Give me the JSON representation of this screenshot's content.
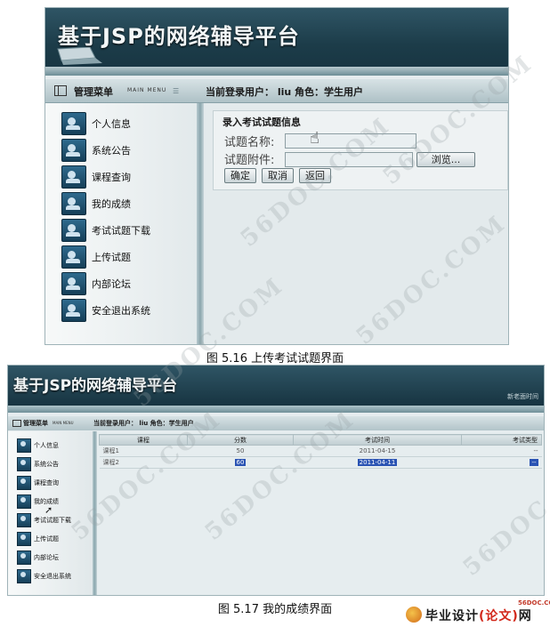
{
  "app": {
    "title": "基于JSP的网络辅导平台",
    "menu_title": "管理菜单",
    "menu_subtitle": "MAIN MENU",
    "user_bar": "当前登录用户：  liu     角色：学生用户",
    "user_bar_small": "当前登录用户：  liu    角色：学生用户",
    "top_right_link": "新老面时间"
  },
  "sidebar": {
    "items": [
      {
        "label": "个人信息"
      },
      {
        "label": "系统公告"
      },
      {
        "label": "课程查询"
      },
      {
        "label": "我的成绩"
      },
      {
        "label": "考试试题下载"
      },
      {
        "label": "上传试题"
      },
      {
        "label": "内部论坛"
      },
      {
        "label": "安全退出系统"
      }
    ]
  },
  "upload_form": {
    "title": "录入考试试题信息",
    "name_label": "试题名称:",
    "name_value": "",
    "attachment_label": "试题附件:",
    "attachment_value": "",
    "browse_label": "浏览...",
    "confirm_label": "确定",
    "cancel_label": "取消",
    "back_label": "返回"
  },
  "captions": {
    "fig1": "图 5.16 上传考试试题界面",
    "fig2": "图 5.17 我的成绩界面"
  },
  "grades_table": {
    "headers": [
      "课程",
      "分数",
      "考试时间",
      "考试类型"
    ],
    "rows": [
      [
        "课程1",
        "50",
        "2011-04-15",
        "--"
      ],
      [
        "课程2",
        "60",
        "2011-04-11",
        "--"
      ]
    ],
    "selected_row_index": 1
  },
  "watermark": "56DOC.COM",
  "logo": {
    "top_text": "56DOC.COM",
    "main_text": "毕业设计",
    "main_text_red": "(论文)",
    "main_text_tail": "网"
  },
  "colors": {
    "banner": "#1c3c49",
    "icon": "#2f6a8d",
    "selection": "#2a53b3",
    "logo_red": "#d2281b"
  }
}
